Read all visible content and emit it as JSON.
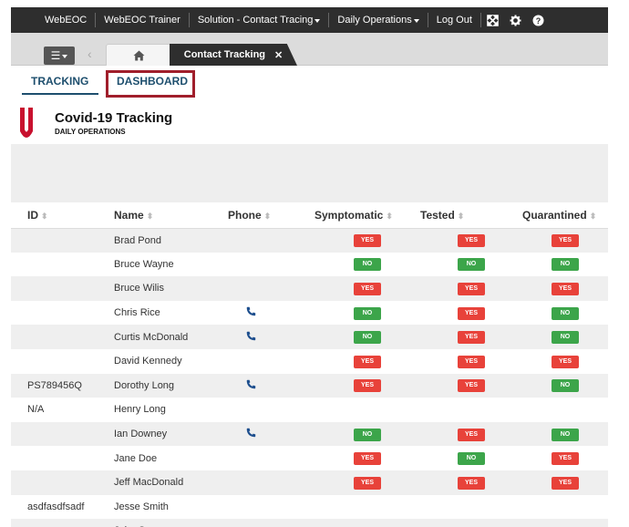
{
  "topnav": {
    "items": [
      {
        "label": "WebEOC",
        "caret": false
      },
      {
        "label": "WebEOC Trainer",
        "caret": false
      },
      {
        "label": "Solution - Contact Tracing",
        "caret": true
      },
      {
        "label": "Daily Operations",
        "caret": true
      },
      {
        "label": "Log Out",
        "caret": false
      }
    ],
    "icons": [
      "expand-icon",
      "gear-icon",
      "help-icon"
    ]
  },
  "tabbar": {
    "home_tab_icon": "home-icon",
    "active_tab_label": "Contact Tracking",
    "close_glyph": "✕"
  },
  "subtabs": {
    "tracking": "TRACKING",
    "dashboard": "DASHBOARD"
  },
  "header": {
    "title": "Covid-19 Tracking",
    "subtitle": "DAILY OPERATIONS"
  },
  "table": {
    "columns": [
      "ID",
      "Name",
      "Phone",
      "Symptomatic",
      "Tested",
      "Quarantined"
    ],
    "rows": [
      {
        "id": "",
        "name": "Brad Pond",
        "phone": false,
        "symptomatic": "YES",
        "tested": "YES",
        "quarantined": "YES"
      },
      {
        "id": "",
        "name": "Bruce Wayne",
        "phone": false,
        "symptomatic": "NO",
        "tested": "NO",
        "quarantined": "NO"
      },
      {
        "id": "",
        "name": "Bruce Wilis",
        "phone": false,
        "symptomatic": "YES",
        "tested": "YES",
        "quarantined": "YES"
      },
      {
        "id": "",
        "name": "Chris Rice",
        "phone": true,
        "symptomatic": "NO",
        "tested": "YES",
        "quarantined": "NO"
      },
      {
        "id": "",
        "name": "Curtis McDonald",
        "phone": true,
        "symptomatic": "NO",
        "tested": "YES",
        "quarantined": "NO"
      },
      {
        "id": "",
        "name": "David Kennedy",
        "phone": false,
        "symptomatic": "YES",
        "tested": "YES",
        "quarantined": "YES"
      },
      {
        "id": "PS789456Q",
        "name": "Dorothy Long",
        "phone": true,
        "symptomatic": "YES",
        "tested": "YES",
        "quarantined": "NO"
      },
      {
        "id": "N/A",
        "name": "Henry Long",
        "phone": false,
        "symptomatic": "",
        "tested": "",
        "quarantined": ""
      },
      {
        "id": "",
        "name": "Ian Downey",
        "phone": true,
        "symptomatic": "NO",
        "tested": "YES",
        "quarantined": "NO"
      },
      {
        "id": "",
        "name": "Jane Doe",
        "phone": false,
        "symptomatic": "YES",
        "tested": "NO",
        "quarantined": "YES"
      },
      {
        "id": "",
        "name": "Jeff MacDonald",
        "phone": false,
        "symptomatic": "YES",
        "tested": "YES",
        "quarantined": "YES"
      },
      {
        "id": "asdfasdfsadf",
        "name": "Jesse Smith",
        "phone": false,
        "symptomatic": "",
        "tested": "",
        "quarantined": ""
      },
      {
        "id": "",
        "name": "John Sm",
        "phone": false,
        "symptomatic": "",
        "tested": "",
        "quarantined": ""
      }
    ]
  },
  "colors": {
    "nav_bg": "#2e2e2e",
    "accent": "#1e4f6e",
    "highlight_box": "#a01e2b",
    "yes": "#e8423a",
    "no": "#3ca54a",
    "logo": "#c8102e"
  }
}
